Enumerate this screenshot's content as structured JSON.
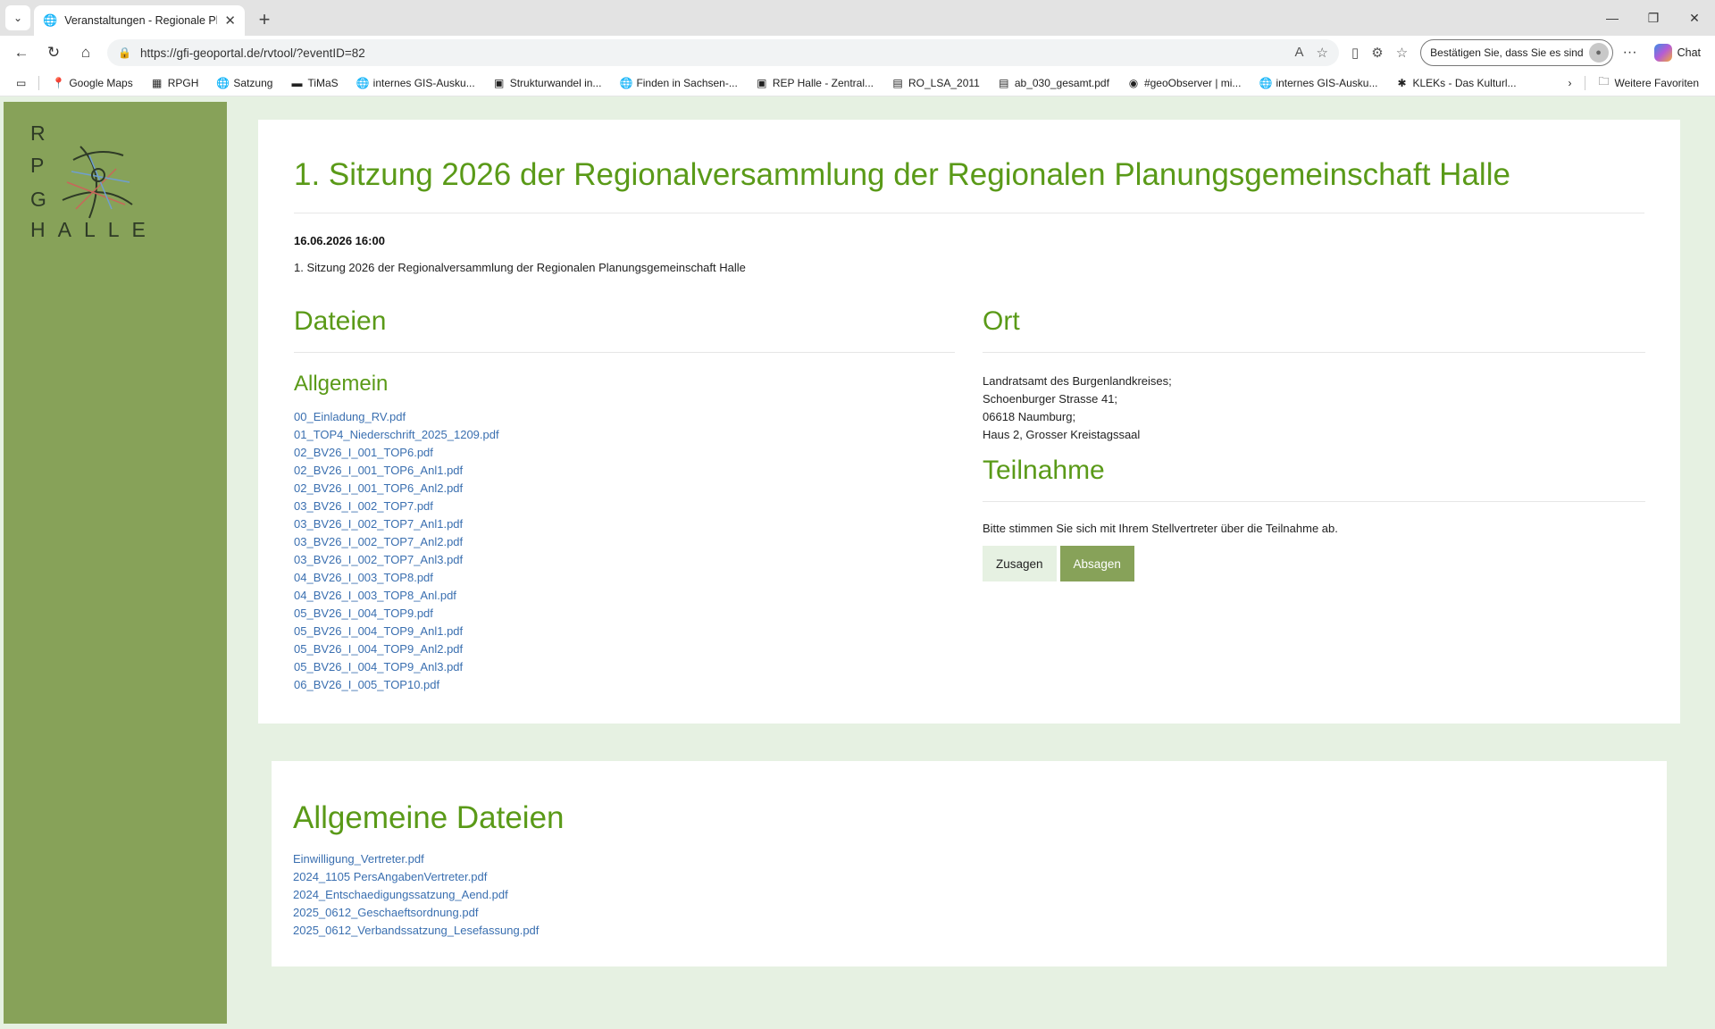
{
  "browser": {
    "tab_title": "Veranstaltungen - Regionale Planu",
    "url": "https://gfi-geoportal.de/rvtool/?eventID=82",
    "profile_label": "Bestätigen Sie, dass Sie es sind",
    "chat_label": "Chat"
  },
  "favorites": [
    {
      "label": "Google Maps",
      "icon": "maps-pin-icon"
    },
    {
      "label": "RPGH",
      "icon": "rpgh-icon"
    },
    {
      "label": "Satzung",
      "icon": "globe-icon"
    },
    {
      "label": "TiMaS",
      "icon": "timas-icon"
    },
    {
      "label": "internes GIS-Ausku...",
      "icon": "globe-icon"
    },
    {
      "label": "Strukturwandel in...",
      "icon": "map-icon"
    },
    {
      "label": "Finden in Sachsen-...",
      "icon": "globe-icon"
    },
    {
      "label": "REP Halle - Zentral...",
      "icon": "map-icon"
    },
    {
      "label": "RO_LSA_2011",
      "icon": "pdf-icon"
    },
    {
      "label": "ab_030_gesamt.pdf",
      "icon": "pdf-icon"
    },
    {
      "label": "#geoObserver | mi...",
      "icon": "geoobserver-icon"
    },
    {
      "label": "internes GIS-Ausku...",
      "icon": "globe-icon"
    },
    {
      "label": "KLEKs - Das Kulturl...",
      "icon": "kleks-icon"
    }
  ],
  "favorites_more": "Weitere Favoriten",
  "logo": {
    "letters_vertical": [
      "R",
      "P",
      "G"
    ],
    "bottom": "HALLE"
  },
  "event": {
    "title": "1. Sitzung 2026 der Regionalversammlung der Regionalen Planungsgemeinschaft Halle",
    "datetime": "16.06.2026 16:00",
    "description": "1. Sitzung 2026 der Regionalversammlung der Regionalen Planungsgemeinschaft Halle"
  },
  "files_section": {
    "heading": "Dateien",
    "subheading": "Allgemein",
    "files": [
      "00_Einladung_RV.pdf",
      "01_TOP4_Niederschrift_2025_1209.pdf",
      "02_BV26_I_001_TOP6.pdf",
      "02_BV26_I_001_TOP6_Anl1.pdf",
      "02_BV26_I_001_TOP6_Anl2.pdf",
      "03_BV26_I_002_TOP7.pdf",
      "03_BV26_I_002_TOP7_Anl1.pdf",
      "03_BV26_I_002_TOP7_Anl2.pdf",
      "03_BV26_I_002_TOP7_Anl3.pdf",
      "04_BV26_I_003_TOP8.pdf",
      "04_BV26_I_003_TOP8_Anl.pdf",
      "05_BV26_I_004_TOP9.pdf",
      "05_BV26_I_004_TOP9_Anl1.pdf",
      "05_BV26_I_004_TOP9_Anl2.pdf",
      "05_BV26_I_004_TOP9_Anl3.pdf",
      "06_BV26_I_005_TOP10.pdf"
    ]
  },
  "location": {
    "heading": "Ort",
    "lines": [
      "Landratsamt des Burgenlandkreises;",
      "Schoenburger Strasse 41;",
      "06618 Naumburg;",
      "Haus 2, Grosser Kreistagssaal"
    ]
  },
  "participation": {
    "heading": "Teilnahme",
    "text": "Bitte stimmen Sie sich mit Ihrem Stellvertreter über die Teilnahme ab.",
    "accept_label": "Zusagen",
    "decline_label": "Absagen"
  },
  "general_files": {
    "heading": "Allgemeine Dateien",
    "files": [
      "Einwilligung_Vertreter.pdf",
      "2024_1105 PersAngabenVertreter.pdf",
      "2024_Entschaedigungssatzung_Aend.pdf",
      "2025_0612_Geschaeftsordnung.pdf",
      "2025_0612_Verbandssatzung_Lesefassung.pdf"
    ]
  },
  "colors": {
    "accent_green": "#5a9a18",
    "sidebar_green": "#87a259",
    "page_bg": "#e6f1e2",
    "link_blue": "#3a6fb0"
  }
}
